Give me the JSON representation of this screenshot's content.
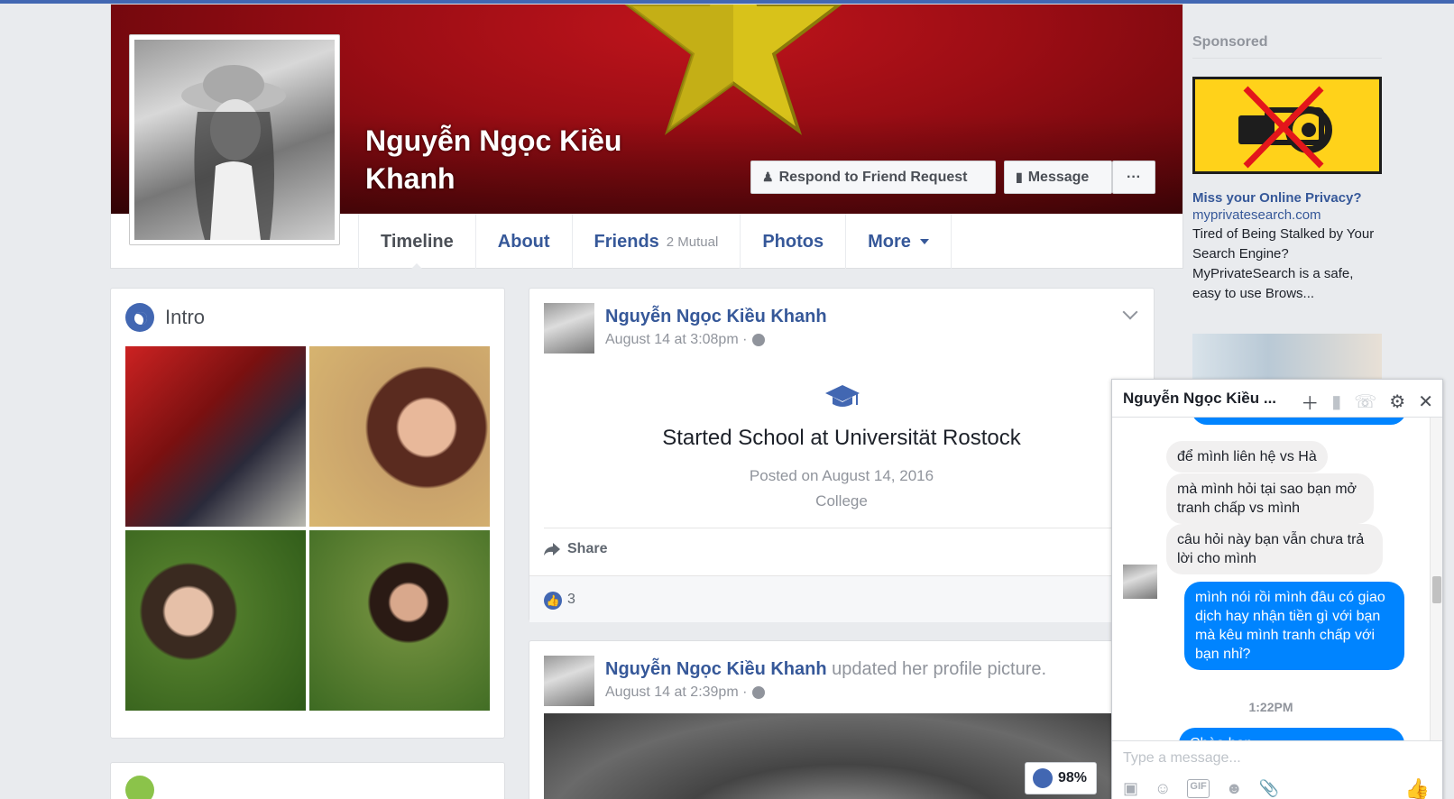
{
  "profile": {
    "name": "Nguyễn Ngọc Kiều Khanh",
    "respond_label": "Respond to Friend Request",
    "message_label": "Message",
    "more_dots": "···"
  },
  "tabs": [
    {
      "label": "Timeline"
    },
    {
      "label": "About"
    },
    {
      "label": "Friends",
      "sub": "2 Mutual"
    },
    {
      "label": "Photos"
    },
    {
      "label": "More"
    }
  ],
  "intro": {
    "title": "Intro"
  },
  "post1": {
    "author": "Nguyễn Ngọc Kiều Khanh",
    "time": "August 14 at 3:08pm ·",
    "title": "Started School at Universität Rostock",
    "posted": "Posted on August 14, 2016",
    "category": "College",
    "share_label": "Share",
    "like_count": "3"
  },
  "post2": {
    "author": "Nguyễn Ngọc Kiều Khanh",
    "action": "updated her profile picture.",
    "time": "August 14 at 2:39pm ·",
    "percent": "98%"
  },
  "sponsored": {
    "title": "Sponsored",
    "headline": "Miss your Online Privacy?",
    "url": "myprivatesearch.com",
    "body": "Tired of Being Stalked by Your Search Engine? MyPrivateSearch is a safe, easy to use Brows..."
  },
  "chat": {
    "title": "Nguyễn Ngọc Kiều ...",
    "messages": [
      "để mình liên hệ vs Hà",
      "mà mình hỏi tại sao bạn mở tranh chấp vs mình",
      "câu hỏi này bạn vẫn chưa trả lời cho mình",
      "mình nói rồi mình đâu có giao dịch hay nhận tiền gì với bạn mà kêu mình tranh chấp với bạn nhỉ?",
      "Chào bạn"
    ],
    "time": "1:22PM",
    "placeholder": "Type a message..."
  },
  "colors": {
    "brand": "#4267b2",
    "link": "#365899",
    "messenger": "#0084ff",
    "cover": "#9a0d14",
    "star": "#d8c21a"
  }
}
